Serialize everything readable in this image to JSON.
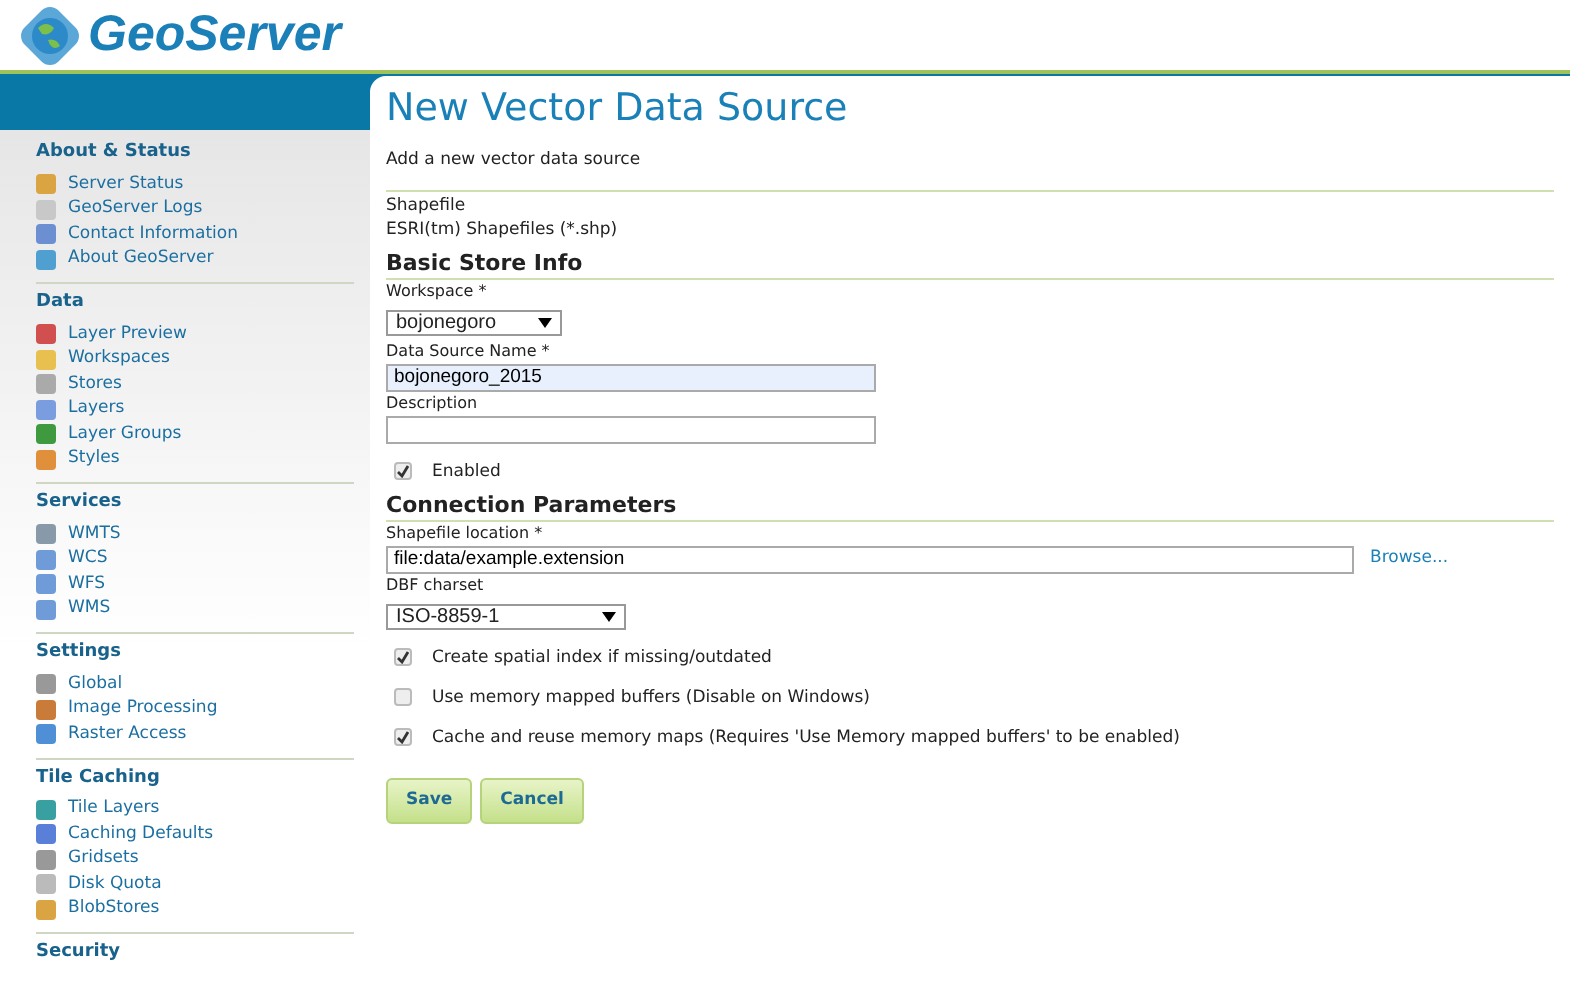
{
  "header": {
    "logo_text": "GeoServer"
  },
  "sidebar": {
    "sections": [
      {
        "title": "About & Status",
        "items": [
          {
            "label": "Server Status"
          },
          {
            "label": "GeoServer Logs"
          },
          {
            "label": "Contact Information"
          },
          {
            "label": "About GeoServer"
          }
        ]
      },
      {
        "title": "Data",
        "items": [
          {
            "label": "Layer Preview"
          },
          {
            "label": "Workspaces"
          },
          {
            "label": "Stores"
          },
          {
            "label": "Layers"
          },
          {
            "label": "Layer Groups"
          },
          {
            "label": "Styles"
          }
        ]
      },
      {
        "title": "Services",
        "items": [
          {
            "label": "WMTS"
          },
          {
            "label": "WCS"
          },
          {
            "label": "WFS"
          },
          {
            "label": "WMS"
          }
        ]
      },
      {
        "title": "Settings",
        "items": [
          {
            "label": "Global"
          },
          {
            "label": "Image Processing"
          },
          {
            "label": "Raster Access"
          }
        ]
      },
      {
        "title": "Tile Caching",
        "items": [
          {
            "label": "Tile Layers"
          },
          {
            "label": "Caching Defaults"
          },
          {
            "label": "Gridsets"
          },
          {
            "label": "Disk Quota"
          },
          {
            "label": "BlobStores"
          }
        ]
      },
      {
        "title": "Security"
      }
    ]
  },
  "page": {
    "title": "New Vector Data Source",
    "description": "Add a new vector data source",
    "store_type": {
      "name": "Shapefile",
      "description": "ESRI(tm) Shapefiles (*.shp)"
    },
    "sections": [
      {
        "title": "Basic Store Info",
        "fields": [
          {
            "kind": "select",
            "label": "Workspace *",
            "value": "bojonegoro"
          },
          {
            "kind": "text",
            "label": "Data Source Name *",
            "value": "bojonegoro_2015",
            "highlighted": true
          },
          {
            "kind": "text",
            "label": "Description"
          },
          {
            "kind": "checkbox",
            "label": "Enabled",
            "checked": true
          }
        ]
      },
      {
        "title": "Connection Parameters",
        "fields": [
          {
            "kind": "file",
            "label": "Shapefile location *",
            "value": "file:data/example.extension",
            "link": "Browse..."
          },
          {
            "kind": "select",
            "label": "DBF charset",
            "value": "ISO-8859-1",
            "wide": true
          },
          {
            "kind": "checkbox",
            "label": "Create spatial index if missing/outdated",
            "checked": true
          },
          {
            "kind": "checkbox",
            "label": "Use memory mapped buffers (Disable on Windows)",
            "checked": false
          },
          {
            "kind": "checkbox",
            "label": "Cache and reuse memory maps (Requires 'Use Memory mapped buffers' to be enabled)",
            "checked": true
          }
        ]
      }
    ]
  },
  "buttons": [
    {
      "label": "Save"
    },
    {
      "label": "Cancel"
    }
  ]
}
